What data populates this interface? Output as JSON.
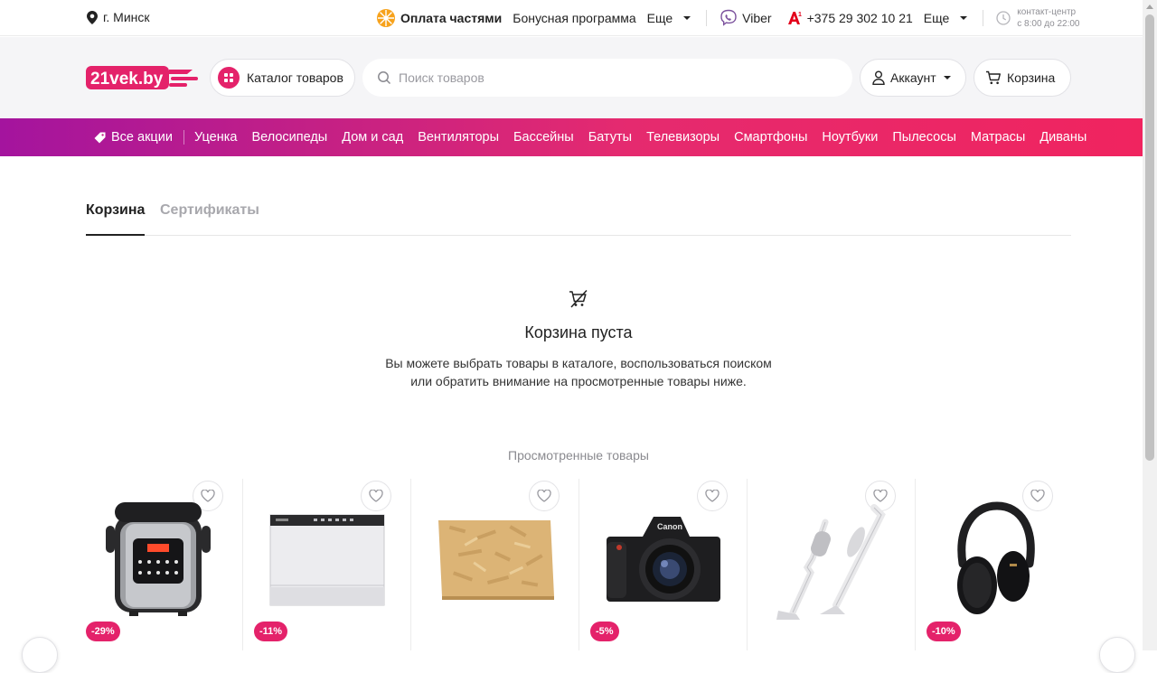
{
  "topbar": {
    "city": "г. Минск",
    "installments": "Оплата частями",
    "bonus": "Бонусная программа",
    "more1": "Еще",
    "viber": "Viber",
    "phone": "+375 29 302 10 21",
    "more2": "Еще",
    "contact_label": "контакт-центр",
    "contact_hours": "с 8:00 до 22:00"
  },
  "header": {
    "logo": "21vek.by",
    "catalog_label": "Каталог товаров",
    "search_placeholder": "Поиск товаров",
    "account_label": "Аккаунт",
    "cart_label": "Корзина"
  },
  "nav": {
    "promo": "Все акции",
    "items": [
      "Уценка",
      "Велосипеды",
      "Дом и сад",
      "Вентиляторы",
      "Бассейны",
      "Батуты",
      "Телевизоры",
      "Смартфоны",
      "Ноутбуки",
      "Пылесосы",
      "Матрасы",
      "Диваны"
    ]
  },
  "tabs": {
    "cart": "Корзина",
    "certificates": "Сертификаты"
  },
  "empty": {
    "title": "Корзина пуста",
    "line1": "Вы можете выбрать товары в каталоге, воспользоваться поиском",
    "line2": "или обратить внимание на просмотренные товары ниже."
  },
  "viewed": {
    "title": "Просмотренные товары",
    "products": [
      {
        "name": "multicooker",
        "discount": "-29%"
      },
      {
        "name": "dishwasher",
        "discount": "-11%"
      },
      {
        "name": "osb-board",
        "discount": ""
      },
      {
        "name": "camera",
        "discount": "-5%"
      },
      {
        "name": "vacuum",
        "discount": ""
      },
      {
        "name": "headphones",
        "discount": "-10%"
      }
    ]
  },
  "colors": {
    "brand_pink": "#e4226a",
    "brand_purple": "#a4149e",
    "text_dark": "#222222",
    "muted": "#a8a8ad"
  }
}
